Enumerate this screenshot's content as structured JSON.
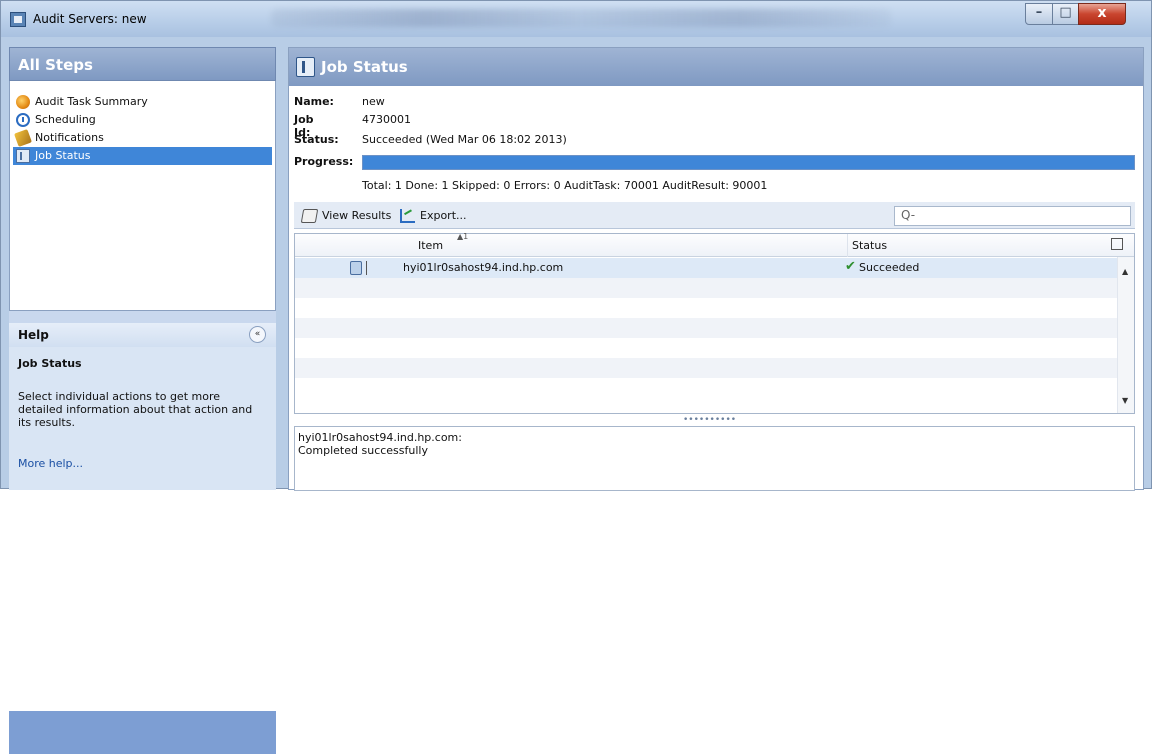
{
  "window": {
    "title": "Audit Servers: new",
    "controls": {
      "minimize": "–",
      "maximize": "□",
      "close": "x"
    }
  },
  "sidebar": {
    "header": "All Steps",
    "items": [
      {
        "label": "Audit Task Summary",
        "icon": "audit-task-summary-icon",
        "selected": false
      },
      {
        "label": "Scheduling",
        "icon": "clock-icon",
        "selected": false
      },
      {
        "label": "Notifications",
        "icon": "notification-icon",
        "selected": false
      },
      {
        "label": "Job Status",
        "icon": "job-status-icon",
        "selected": true
      }
    ]
  },
  "help": {
    "header": "Help",
    "collapse_glyph": "«",
    "title": "Job Status",
    "text": "Select individual actions to get more detailed information about that action and its results.",
    "link": "More help..."
  },
  "main": {
    "header": "Job Status",
    "fields": {
      "name_label": "Name:",
      "name_value": "new",
      "jobid_label": "Job Id:",
      "jobid_value": "4730001",
      "status_label": "Status:",
      "status_value": "Succeeded (Wed Mar 06 18:02 2013)",
      "progress_label": "Progress:"
    },
    "progress_fraction": 1.0,
    "summary": "Total: 1  Done: 1  Skipped: 0  Errors: 0  AuditTask: 70001  AuditResult: 90001",
    "toolbar": {
      "view_results": "View Results",
      "export": "Export...",
      "search_placeholder": "",
      "search_glyph": "Q-"
    },
    "table": {
      "sort_indicator": "▲1",
      "columns": [
        "Item",
        "Status"
      ],
      "rows": [
        {
          "item": "hyi01lr0sahost94.ind.hp.com",
          "status": "Succeeded",
          "status_icon": "check-icon"
        }
      ]
    },
    "splitter_glyph": "••••••••••",
    "details": {
      "line1": "hyi01lr0sahost94.ind.hp.com:",
      "line2": "Completed successfully"
    }
  },
  "colors": {
    "header_blue": "#8aa3c9",
    "selection_blue": "#3f86d8",
    "success_green": "#2f8f2f",
    "close_red": "#c9452f"
  }
}
